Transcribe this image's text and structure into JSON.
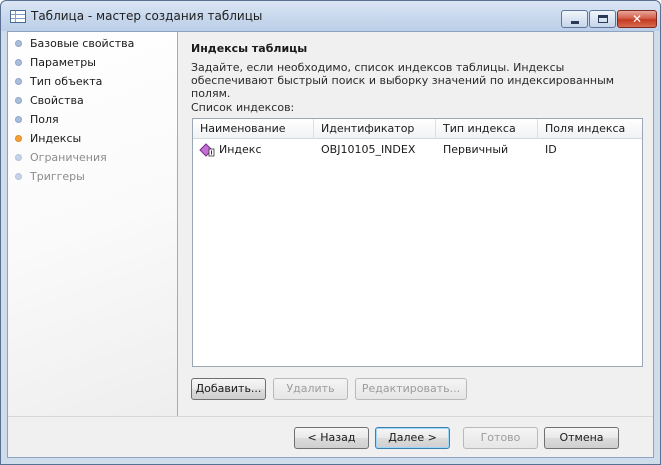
{
  "window": {
    "title": "Таблица - мастер создания таблицы",
    "close_glyph": "✕"
  },
  "nav": {
    "items": [
      {
        "label": "Базовые свойства",
        "state": "normal"
      },
      {
        "label": "Параметры",
        "state": "normal"
      },
      {
        "label": "Тип объекта",
        "state": "normal"
      },
      {
        "label": "Свойства",
        "state": "normal"
      },
      {
        "label": "Поля",
        "state": "normal"
      },
      {
        "label": "Индексы",
        "state": "active"
      },
      {
        "label": "Ограничения",
        "state": "disabled"
      },
      {
        "label": "Триггеры",
        "state": "disabled"
      }
    ]
  },
  "main": {
    "heading": "Индексы таблицы",
    "description": "Задайте, если необходимо, список индексов таблицы. Индексы обеспечивают быстрый поиск и выборку значений по индексированным полям.",
    "list_label": "Список индексов:",
    "columns": [
      "Наименование",
      "Идентификатор",
      "Тип индекса",
      "Поля индекса"
    ],
    "rows": [
      {
        "name": "Индекс",
        "identifier": "OBJ10105_INDEX",
        "type": "Первичный",
        "fields": "ID",
        "icon": "primary-key-index-icon"
      }
    ],
    "buttons": {
      "add": "Добавить...",
      "delete": "Удалить",
      "edit": "Редактировать..."
    }
  },
  "footer": {
    "back": "< Назад",
    "next": "Далее >",
    "finish": "Готово",
    "cancel": "Отмена"
  },
  "colors": {
    "active_step": "#f3a23a",
    "step": "#a9bedb",
    "frame": "#cfdcec"
  }
}
